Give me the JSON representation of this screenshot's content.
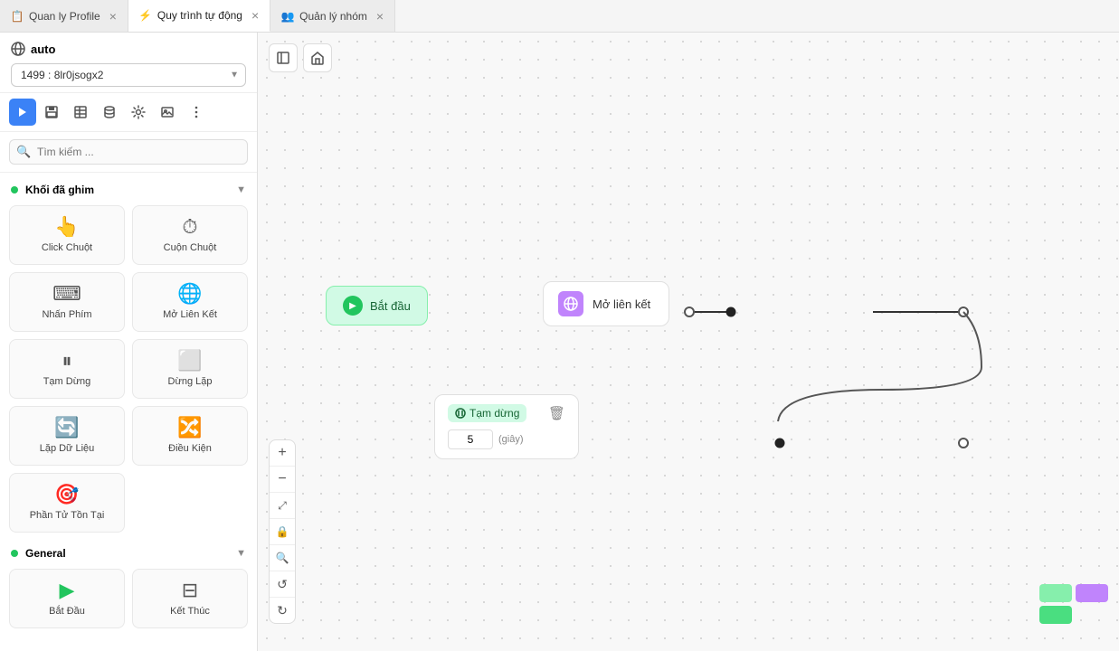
{
  "tabs": [
    {
      "id": "quan-ly-profile",
      "label": "Quan ly Profile",
      "active": false,
      "icon": "📋"
    },
    {
      "id": "quy-trinh-tu-dong",
      "label": "Quy trình tự động",
      "active": true,
      "icon": "⚡"
    },
    {
      "id": "quan-ly-nhom",
      "label": "Quản lý nhóm",
      "active": false,
      "icon": "👥"
    }
  ],
  "sidebar": {
    "auto_label": "auto",
    "profile_value": "1499 : 8lr0jsogx2",
    "toolbar": {
      "play": "▶",
      "save": "💾",
      "table": "⊞",
      "db": "🗄",
      "settings": "⚙",
      "image": "🖼",
      "more": "⋮"
    },
    "search_placeholder": "Tìm kiếm ...",
    "sections": [
      {
        "id": "khoi-da-ghim",
        "label": "Khối đã ghim",
        "expanded": true,
        "blocks": [
          {
            "id": "click-chuot",
            "label": "Click Chuột",
            "icon": "👆"
          },
          {
            "id": "cuon-chuot",
            "label": "Cuộn Chuột",
            "icon": "⏱"
          },
          {
            "id": "nhan-phim",
            "label": "Nhấn Phím",
            "icon": "⌨"
          },
          {
            "id": "mo-lien-ket",
            "label": "Mở Liên Kết",
            "icon": "🌐"
          },
          {
            "id": "tam-dung",
            "label": "Tạm Dừng",
            "icon": "⏸"
          },
          {
            "id": "dung-lap",
            "label": "Dừng Lặp",
            "icon": "⬜"
          },
          {
            "id": "lap-du-lieu",
            "label": "Lặp Dữ Liệu",
            "icon": "🔄"
          },
          {
            "id": "dieu-kien",
            "label": "Điều Kiện",
            "icon": "🔀"
          },
          {
            "id": "phan-tu-ton-tai",
            "label": "Phần Tử Tồn Tại",
            "icon": "🎯"
          }
        ]
      },
      {
        "id": "general",
        "label": "General",
        "expanded": true,
        "blocks": [
          {
            "id": "bat-dau",
            "label": "Bắt Đầu",
            "icon": "▶"
          },
          {
            "id": "ket-thuc",
            "label": "Kết Thúc",
            "icon": "⊟"
          }
        ]
      }
    ]
  },
  "flow": {
    "nodes": {
      "start": {
        "label": "Bắt đầu"
      },
      "open_url": {
        "label": "Mở liên kết"
      },
      "pause": {
        "label": "Tạm dừng",
        "value": "5",
        "unit": "(giây)"
      }
    }
  },
  "zoom_controls": {
    "plus": "+",
    "minus": "−",
    "fit": "⤢",
    "lock": "🔒",
    "search_zoom": "🔍",
    "undo": "↺",
    "redo": "↻"
  }
}
